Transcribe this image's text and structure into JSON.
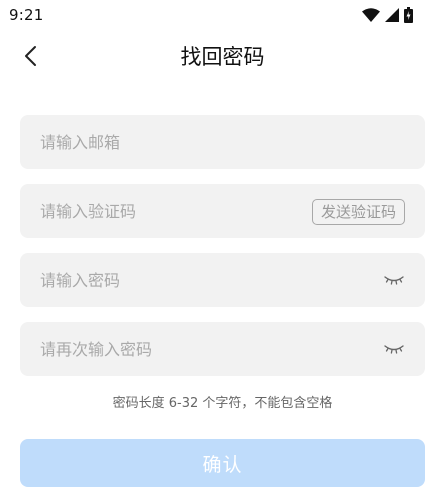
{
  "status_bar": {
    "time": "9:21",
    "icons": [
      "wifi-icon",
      "signal-icon",
      "battery-icon"
    ]
  },
  "header": {
    "title": "找回密码",
    "back_icon": "chevron-left-icon"
  },
  "form": {
    "email": {
      "placeholder": "请输入邮箱",
      "value": ""
    },
    "code": {
      "placeholder": "请输入验证码",
      "value": "",
      "send_button_label": "发送验证码"
    },
    "password": {
      "placeholder": "请输入密码",
      "value": "",
      "toggle_icon": "eye-closed-icon"
    },
    "confirm_password": {
      "placeholder": "请再次输入密码",
      "value": "",
      "toggle_icon": "eye-closed-icon"
    },
    "hint": "密码长度 6-32 个字符，不能包含空格",
    "submit_label": "确认"
  },
  "colors": {
    "field_background": "#f2f2f2",
    "placeholder": "#a9a9a9",
    "button_disabled": "#bfdcfb",
    "button_text": "#ffffff"
  }
}
